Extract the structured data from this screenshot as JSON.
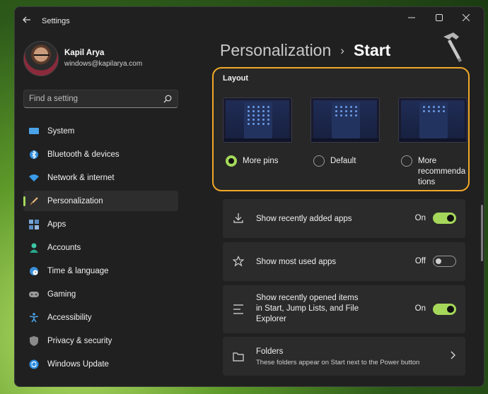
{
  "window": {
    "title": "Settings"
  },
  "profile": {
    "name": "Kapil Arya",
    "email": "windows@kapilarya.com"
  },
  "search": {
    "placeholder": "Find a setting"
  },
  "sidebar": {
    "items": [
      {
        "label": "System",
        "icon": "monitor-icon"
      },
      {
        "label": "Bluetooth & devices",
        "icon": "bluetooth-icon"
      },
      {
        "label": "Network & internet",
        "icon": "wifi-icon"
      },
      {
        "label": "Personalization",
        "icon": "brush-icon",
        "active": true
      },
      {
        "label": "Apps",
        "icon": "apps-icon"
      },
      {
        "label": "Accounts",
        "icon": "person-icon"
      },
      {
        "label": "Time & language",
        "icon": "globe-clock-icon"
      },
      {
        "label": "Gaming",
        "icon": "gamepad-icon"
      },
      {
        "label": "Accessibility",
        "icon": "accessibility-icon"
      },
      {
        "label": "Privacy & security",
        "icon": "shield-icon"
      },
      {
        "label": "Windows Update",
        "icon": "update-icon"
      }
    ]
  },
  "header": {
    "parent": "Personalization",
    "separator": "›",
    "current": "Start"
  },
  "layout": {
    "title": "Layout",
    "options": [
      {
        "label": "More pins",
        "checked": true
      },
      {
        "label": "Default",
        "checked": false
      },
      {
        "label": "More recommenda tions",
        "checked": false
      }
    ]
  },
  "settings": {
    "recent_apps": {
      "label": "Show recently added apps",
      "state": "On",
      "on": true
    },
    "most_used": {
      "label": "Show most used apps",
      "state": "Off",
      "on": false
    },
    "recent_items": {
      "label": "Show recently opened items in Start, Jump Lists, and File Explorer",
      "state": "On",
      "on": true
    },
    "folders": {
      "label": "Folders",
      "description": "These folders appear on Start next to the Power button"
    }
  },
  "colors": {
    "accent": "#a5d85a",
    "highlight_border": "#f0a828",
    "window_bg": "#202020",
    "card_bg": "#2b2b2b"
  }
}
